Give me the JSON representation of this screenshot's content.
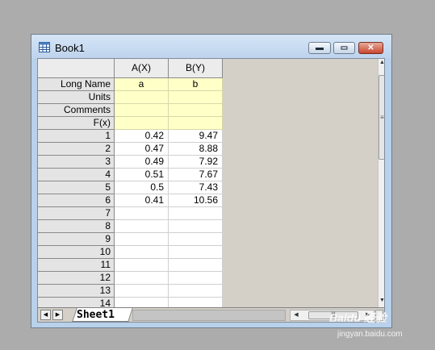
{
  "window": {
    "title": "Book1",
    "icon": "worksheet-grid-icon",
    "controls": {
      "minimize": "minimize-icon",
      "maximize": "maximize-icon",
      "close": "close-icon"
    }
  },
  "worksheet": {
    "columns": [
      "A(X)",
      "B(Y)"
    ],
    "meta_rows": [
      {
        "label": "Long Name",
        "values": [
          "a",
          "b"
        ]
      },
      {
        "label": "Units",
        "values": [
          "",
          ""
        ]
      },
      {
        "label": "Comments",
        "values": [
          "",
          ""
        ]
      },
      {
        "label": "F(x)",
        "values": [
          "",
          ""
        ]
      }
    ],
    "rows": [
      {
        "index": "1",
        "values": [
          "0.42",
          "9.47"
        ]
      },
      {
        "index": "2",
        "values": [
          "0.47",
          "8.88"
        ]
      },
      {
        "index": "3",
        "values": [
          "0.49",
          "7.92"
        ]
      },
      {
        "index": "4",
        "values": [
          "0.51",
          "7.67"
        ]
      },
      {
        "index": "5",
        "values": [
          "0.5",
          "7.43"
        ]
      },
      {
        "index": "6",
        "values": [
          "0.41",
          "10.56"
        ]
      },
      {
        "index": "7",
        "values": [
          "",
          ""
        ]
      },
      {
        "index": "8",
        "values": [
          "",
          ""
        ]
      },
      {
        "index": "9",
        "values": [
          "",
          ""
        ]
      },
      {
        "index": "10",
        "values": [
          "",
          ""
        ]
      },
      {
        "index": "11",
        "values": [
          "",
          ""
        ]
      },
      {
        "index": "12",
        "values": [
          "",
          ""
        ]
      },
      {
        "index": "13",
        "values": [
          "",
          ""
        ]
      },
      {
        "index": "14",
        "values": [
          "",
          ""
        ]
      }
    ]
  },
  "tabs": {
    "sheet_label": "Sheet1",
    "nav": {
      "prev": "◀",
      "next": "▶"
    }
  },
  "watermark": {
    "brand": "Baidu 经验",
    "url": "jingyan.baidu.com"
  }
}
